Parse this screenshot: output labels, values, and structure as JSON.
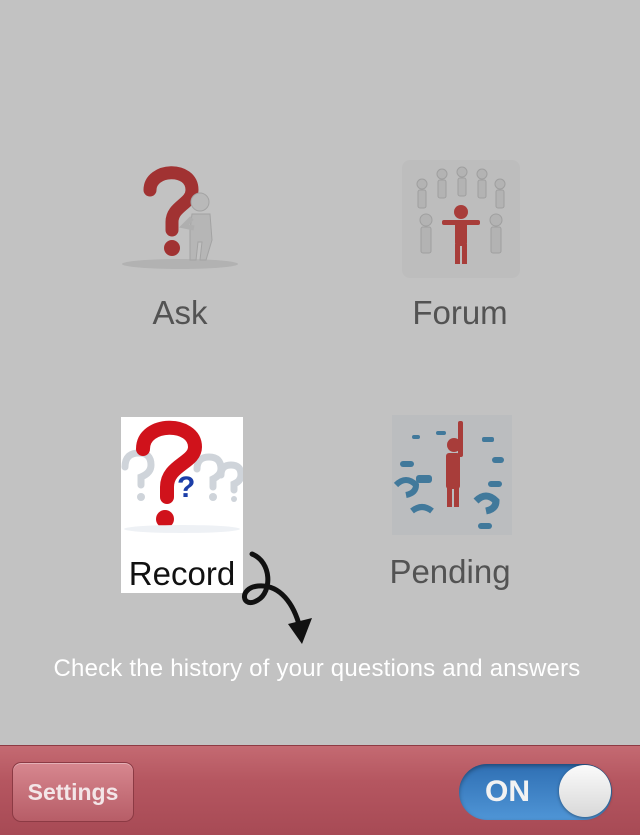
{
  "menu": {
    "ask": {
      "label": "Ask",
      "icon": "question-mark-figure-icon"
    },
    "forum": {
      "label": "Forum",
      "icon": "people-circle-icon"
    },
    "record": {
      "label": "Record",
      "icon": "question-marks-icon"
    },
    "pending": {
      "label": "Pending",
      "icon": "figure-question-marks-icon"
    }
  },
  "tip": {
    "text": "Check the history of your questions and answers"
  },
  "toolbar": {
    "settings_label": "Settings",
    "toggle_label": "ON",
    "toggle_on": true
  },
  "colors": {
    "tabbar": "#b55660",
    "toggle": "#3f85c8",
    "accent_red": "#d22a2a",
    "accent_blue": "#3b8dc0"
  }
}
